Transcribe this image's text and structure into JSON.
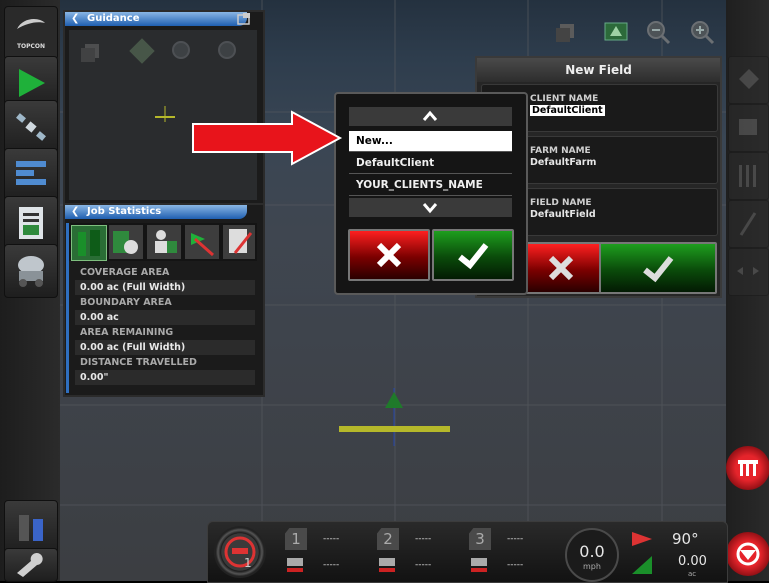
{
  "brand": {
    "logo_text": "TOPCON"
  },
  "guidance_panel": {
    "title": "Guidance"
  },
  "job_statistics": {
    "title": "Job Statistics",
    "stats": [
      {
        "label": "COVERAGE AREA",
        "value": "0.00 ac (Full Width)"
      },
      {
        "label": "BOUNDARY AREA",
        "value": "0.00 ac"
      },
      {
        "label": "AREA REMAINING",
        "value": "0.00 ac (Full Width)"
      },
      {
        "label": "DISTANCE TRAVELLED",
        "value": "0.00\""
      }
    ]
  },
  "new_field": {
    "title": "New Field",
    "client_label": "CLIENT NAME",
    "client_value": "DefaultClient",
    "farm_label": "FARM NAME",
    "farm_value": "DefaultFarm",
    "field_label": "FIELD NAME",
    "field_value": "DefaultField"
  },
  "dropdown": {
    "items": [
      "New...",
      "DefaultClient",
      "YOUR_CLIENTS_NAME"
    ],
    "selected_index": 0
  },
  "bottom_bar": {
    "sections": [
      {
        "number": "1",
        "top": "-----",
        "bottom": "-----"
      },
      {
        "number": "2",
        "top": "-----",
        "bottom": "-----"
      },
      {
        "number": "3",
        "top": "-----",
        "bottom": "-----"
      }
    ],
    "speed_value": "0.0",
    "speed_unit": "mph",
    "heading": "90°",
    "area_value": "0.00",
    "area_unit": "ac",
    "gauge_number": "1"
  },
  "colors": {
    "accent_arrow": "#e8141b",
    "panel_header": "#2f6fc0",
    "selection": "#ffffff"
  }
}
